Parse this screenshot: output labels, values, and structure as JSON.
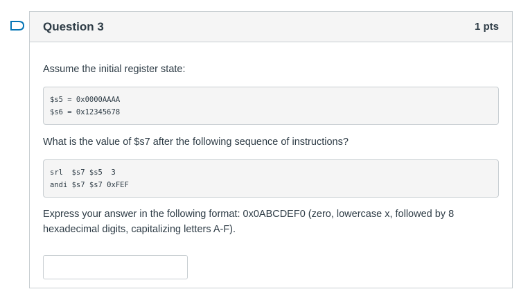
{
  "question": {
    "title": "Question 3",
    "points": "1 pts",
    "intro": "Assume the initial register state:",
    "registers": [
      "$s5 = 0x0000AAAA",
      "$s6 = 0x12345678"
    ],
    "prompt": "What is the value of $s7 after the following sequence of instructions?",
    "instructions": [
      "srl  $s7 $s5  3",
      "andi $s7 $s7 0xFEF"
    ],
    "format_note": "Express your answer in the following format: 0x0ABCDEF0 (zero, lowercase x, followed by 8 hexadecimal digits, capitalizing letters A-F).",
    "answer_value": ""
  },
  "colors": {
    "accent": "#0374b5",
    "text": "#2d3b45",
    "border": "#c7cdd1",
    "header_bg": "#f5f5f5"
  },
  "icons": {
    "flag": "flag-question-icon"
  }
}
